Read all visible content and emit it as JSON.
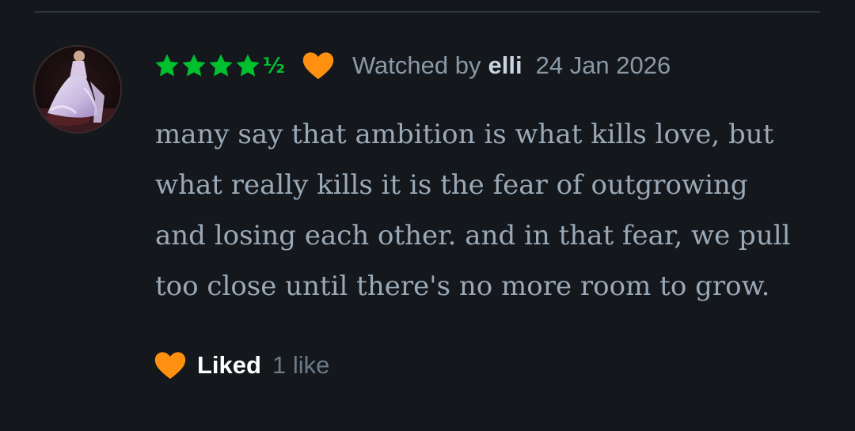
{
  "review": {
    "rating_stars_full": 4,
    "rating_half_glyph": "½",
    "rating_value": 4.5,
    "liked_icon": "heart-icon",
    "watched_by_label": "Watched by",
    "username": "elli",
    "date": "24 Jan 2026",
    "text_lines": [
      "many say that ambition is what kills love, but",
      "what really kills it is the fear of outgrowing",
      "and losing each other. and in that fear, we pull",
      "too close until there's no more room to grow."
    ]
  },
  "actions": {
    "like_label": "Liked",
    "like_count": "1 like"
  },
  "colors": {
    "background": "#14181c",
    "star_green": "#00c030",
    "heart_orange": "#ff9010",
    "muted_text": "#8a99a8",
    "body_text": "#9aa9b8"
  }
}
